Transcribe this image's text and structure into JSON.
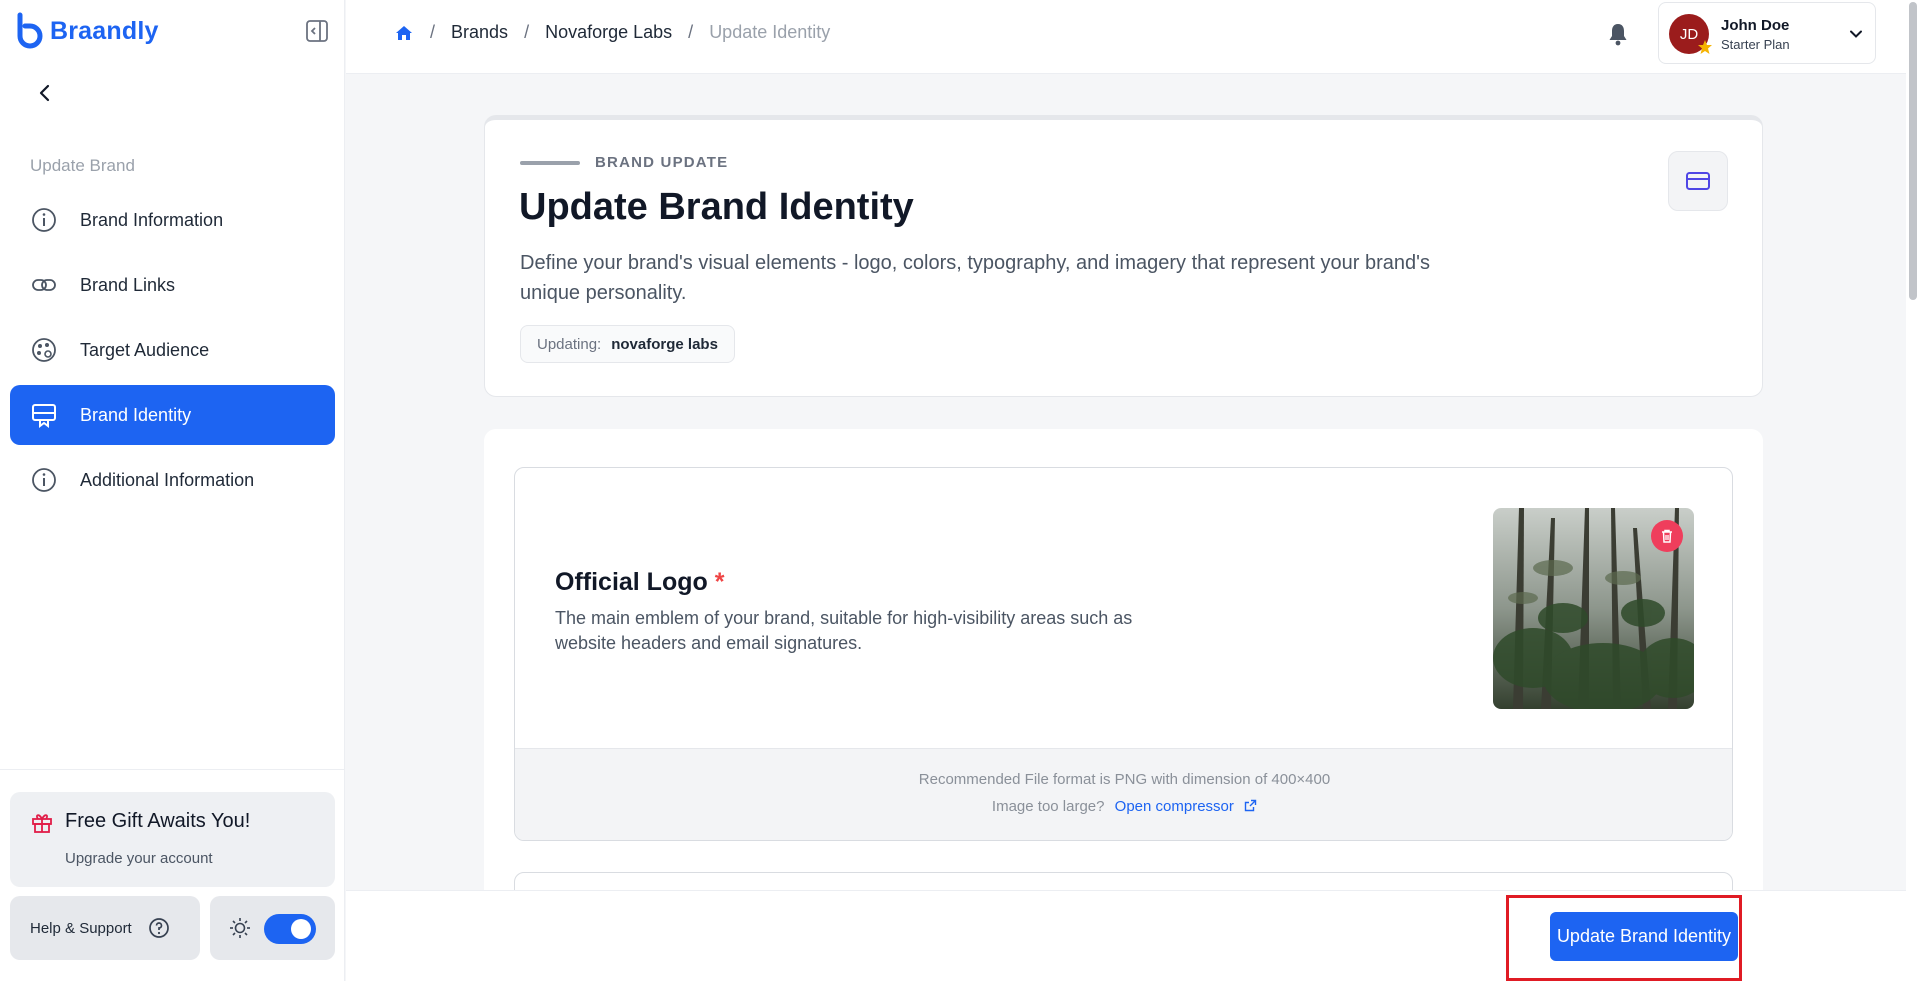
{
  "app": {
    "name": "Braandly",
    "accent": "#1d64f2"
  },
  "sidebar": {
    "section_label": "Update Brand",
    "items": [
      {
        "label": "Brand Information",
        "icon": "info-icon",
        "active": false
      },
      {
        "label": "Brand Links",
        "icon": "link-icon",
        "active": false
      },
      {
        "label": "Target Audience",
        "icon": "palette-icon",
        "active": false
      },
      {
        "label": "Brand Identity",
        "icon": "identity-icon",
        "active": true
      },
      {
        "label": "Additional Information",
        "icon": "info-icon",
        "active": false
      }
    ],
    "gift": {
      "title": "Free Gift Awaits You!",
      "subtitle": "Upgrade your account"
    },
    "help_label": "Help & Support"
  },
  "topbar": {
    "breadcrumbs": [
      "Brands",
      "Novaforge Labs",
      "Update Identity"
    ],
    "user": {
      "initials": "JD",
      "name": "John Doe",
      "plan": "Starter Plan"
    }
  },
  "header": {
    "eyebrow": "BRAND UPDATE",
    "title": "Update Brand Identity",
    "description": "Define your brand's visual elements - logo, colors, typography, and imagery that represent your brand's unique personality.",
    "updating_label": "Updating:",
    "updating_value": "novaforge labs"
  },
  "logo_section": {
    "title": "Official Logo",
    "required_mark": "*",
    "description": "The main emblem of your brand, suitable for high-visibility areas such as website headers and email signatures.",
    "format_hint": "Recommended File format is PNG with dimension of 400×400",
    "large_hint": "Image too large?",
    "compressor_link": "Open compressor"
  },
  "actions": {
    "submit_label": "Update Brand Identity"
  }
}
